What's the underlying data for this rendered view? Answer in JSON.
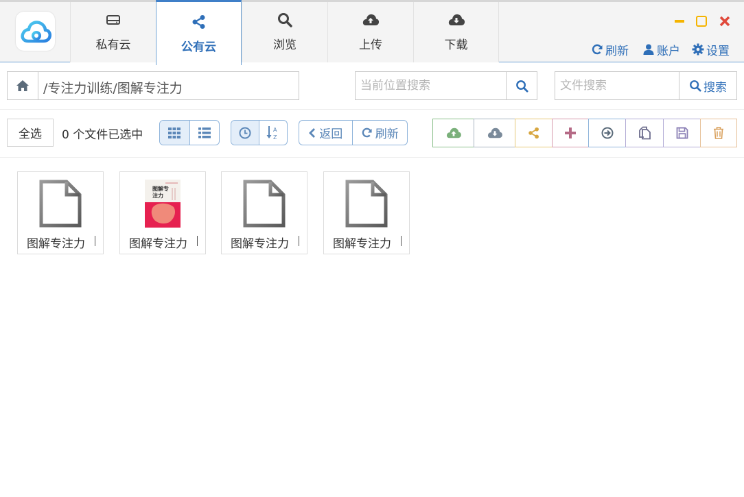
{
  "tabs": [
    {
      "label": "私有云",
      "icon": "drive-icon",
      "active": false
    },
    {
      "label": "公有云",
      "icon": "share-icon",
      "active": true
    },
    {
      "label": "浏览",
      "icon": "search-icon",
      "active": false
    },
    {
      "label": "上传",
      "icon": "cloud-upload-icon",
      "active": false
    },
    {
      "label": "下载",
      "icon": "cloud-download-icon",
      "active": false
    }
  ],
  "top_actions": {
    "refresh": "刷新",
    "account": "账户",
    "settings": "设置"
  },
  "path": "/专注力训练/图解专注力",
  "search": {
    "location_placeholder": "当前位置搜索",
    "file_placeholder": "文件搜索",
    "file_button": "搜索"
  },
  "toolbar": {
    "select_all": "全选",
    "selected_count": "0 个文件已选中",
    "back": "返回",
    "refresh": "刷新"
  },
  "actions": [
    {
      "icon": "cloud-upload-icon",
      "color": "#7ab07a"
    },
    {
      "icon": "cloud-download-icon",
      "color": "#7a8a9a"
    },
    {
      "icon": "share-icon",
      "color": "#d7a640"
    },
    {
      "icon": "plus-icon",
      "color": "#c0778f"
    },
    {
      "icon": "move-icon",
      "color": "#5b87b8"
    },
    {
      "icon": "copy-icon",
      "color": "#8f87b8"
    },
    {
      "icon": "save-icon",
      "color": "#8f87b8"
    },
    {
      "icon": "trash-icon",
      "color": "#d7a640"
    }
  ],
  "files": [
    {
      "name": "图解专注力",
      "type": "document"
    },
    {
      "name": "图解专注力",
      "type": "image",
      "cover_title": "图解专注力"
    },
    {
      "name": "图解专注力",
      "type": "document"
    },
    {
      "name": "图解专注力",
      "type": "document"
    }
  ],
  "colors": {
    "accent": "#2f6fb8",
    "window_minimize": "#f5b400",
    "window_maximize": "#f5b400",
    "window_close": "#e0483a"
  }
}
